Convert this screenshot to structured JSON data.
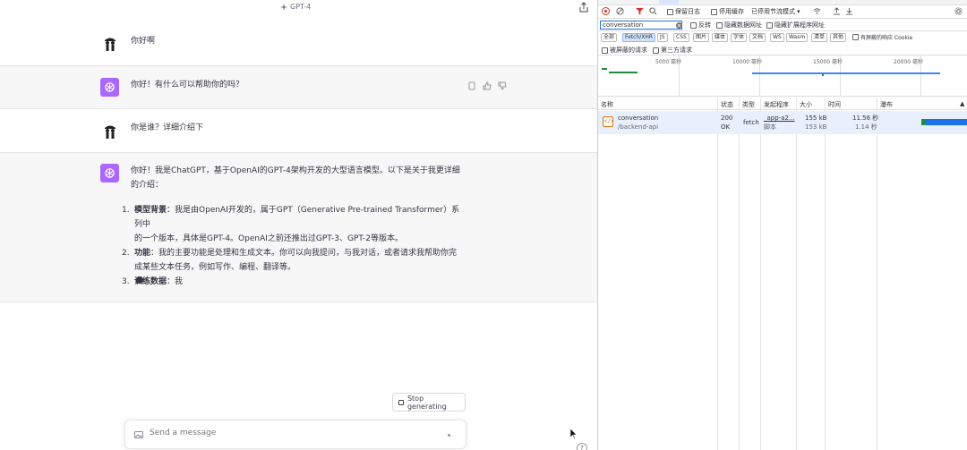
{
  "chat": {
    "model_label": "GPT-4",
    "messages": [
      {
        "role": "user",
        "text": "你好啊"
      },
      {
        "role": "assistant",
        "text": "你好！有什么可以帮助你的吗？"
      },
      {
        "role": "user",
        "text": "你是谁？详细介绍下"
      },
      {
        "role": "assistant",
        "intro_line1": "你好！我是ChatGPT，基于OpenAI的GPT-4架构开发的大型语言模型。以下是关于我更详细",
        "intro_line2": "的介绍：",
        "items": [
          {
            "num": "1.",
            "title": "模型背景",
            "line1": "：我是由OpenAI开发的，属于GPT（Generative Pre-trained Transformer）系列中",
            "line2": "的一个版本，具体是GPT-4。OpenAI之前还推出过GPT-3、GPT-2等版本。"
          },
          {
            "num": "2.",
            "title": "功能",
            "line1": "：我的主要功能是处理和生成文本。你可以向我提问，与我对话，或者请求我帮助你完",
            "line2": "成某些文本任务，例如写作、编程、翻译等。"
          },
          {
            "num": "3.",
            "title": "训练数据",
            "line1": "：我",
            "line2": ""
          }
        ]
      }
    ],
    "stop_label": "Stop generating",
    "composer_placeholder": "Send a message",
    "help_label": "?"
  },
  "devtools": {
    "toolbar": {
      "preserve_log": "保留日志",
      "disable_cache": "停用缓存",
      "throttle": "已停用节流模式"
    },
    "filter": {
      "value": "conversation",
      "invert": "反转",
      "hide_data_urls": "隐藏数据网址",
      "hide_extension_urls": "隐藏扩展程序网址"
    },
    "types": [
      "全部",
      "Fetch/XHR",
      "JS",
      "CSS",
      "图片",
      "媒体",
      "字体",
      "文档",
      "WS",
      "Wasm",
      "清单",
      "其他"
    ],
    "blocked_cookies": "有屏蔽的响应 Cookie",
    "options": {
      "blocked_requests": "被屏蔽的请求",
      "third_party": "第三方请求"
    },
    "overview_labels": [
      "5000 毫秒",
      "10000 毫秒",
      "15000 毫秒",
      "20000 毫秒"
    ],
    "columns": {
      "name": "名称",
      "status": "状态",
      "type": "类型",
      "initiator": "发起程序",
      "size": "大小",
      "time": "时间",
      "waterfall": "瀑布"
    },
    "request": {
      "name": "conversation",
      "path": "/backend-api",
      "status": "200",
      "status_text": "OK",
      "type": "fetch",
      "initiator": "_app-a2...",
      "initiator_sub": "脚本",
      "size": "155 kB",
      "size_sub": "153 kB",
      "time": "11.56 秒",
      "time_sub": "1.14 秒"
    }
  }
}
